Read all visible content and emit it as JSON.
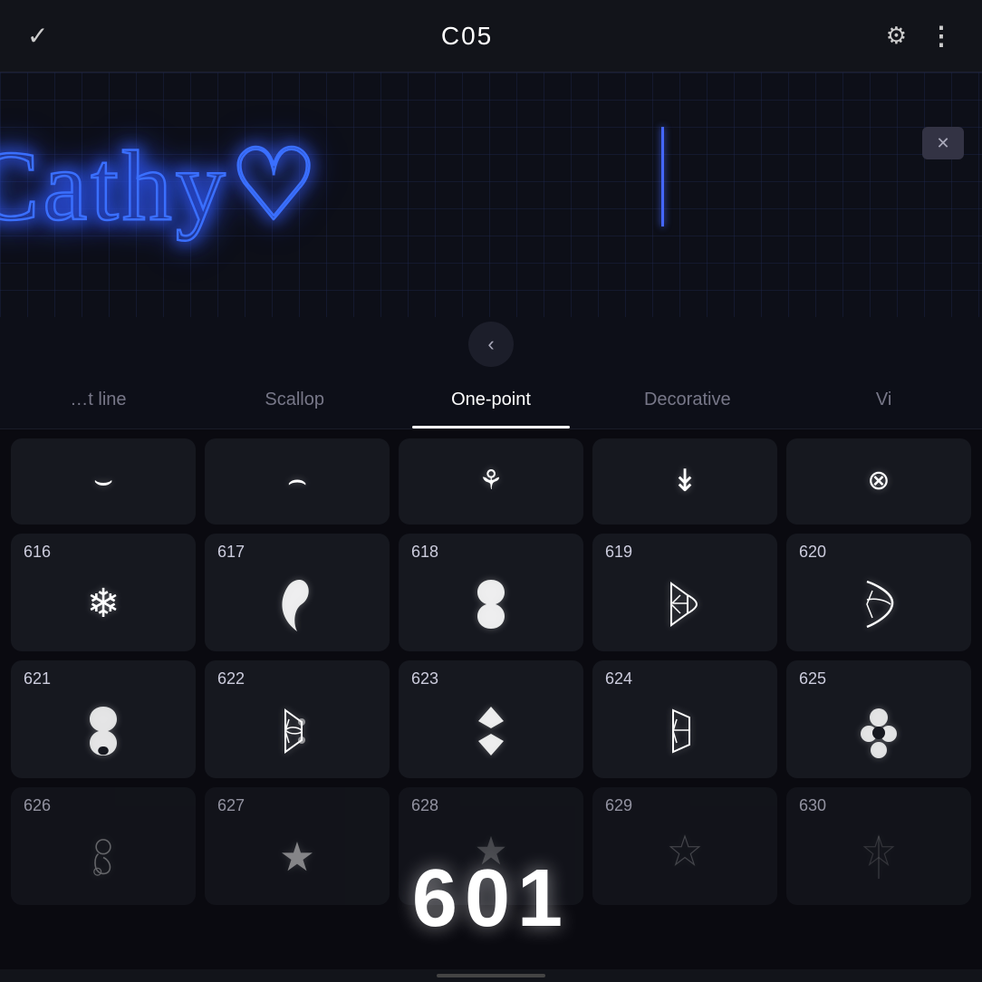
{
  "topbar": {
    "check_label": "✓",
    "title": "C05",
    "gear_label": "⚙",
    "dots_label": "⋮"
  },
  "canvas": {
    "text": "Cathy♡",
    "delete_label": "✕"
  },
  "back_button": {
    "label": "‹"
  },
  "tabs": [
    {
      "id": "straight-line",
      "label": "t line",
      "active": false
    },
    {
      "id": "scallop",
      "label": "Scallop",
      "active": false
    },
    {
      "id": "one-point",
      "label": "One-point",
      "active": true
    },
    {
      "id": "decorative",
      "label": "Decorative",
      "active": false
    },
    {
      "id": "vi",
      "label": "Vi",
      "active": false
    }
  ],
  "stitch_rows": [
    {
      "row_type": "partial",
      "cards": [
        {
          "number": "",
          "icon": "⌣"
        },
        {
          "number": "",
          "icon": "∪"
        },
        {
          "number": "",
          "icon": "⊕"
        },
        {
          "number": "",
          "icon": "↓"
        },
        {
          "number": "",
          "icon": "⊗"
        }
      ]
    },
    {
      "row_type": "full",
      "cards": [
        {
          "number": "616",
          "icon": "❄"
        },
        {
          "number": "617",
          "icon": "🌀"
        },
        {
          "number": "618",
          "icon": "🤍"
        },
        {
          "number": "619",
          "icon": "🔷"
        },
        {
          "number": "620",
          "icon": "🔺"
        }
      ]
    },
    {
      "row_type": "full",
      "cards": [
        {
          "number": "621",
          "icon": "♦"
        },
        {
          "number": "622",
          "icon": "❧"
        },
        {
          "number": "623",
          "icon": "◆"
        },
        {
          "number": "624",
          "icon": "⚑"
        },
        {
          "number": "625",
          "icon": "✿"
        }
      ]
    },
    {
      "row_type": "partial-bottom",
      "cards": [
        {
          "number": "626",
          "icon": "⚘"
        },
        {
          "number": "627",
          "icon": "★"
        },
        {
          "number": "628",
          "icon": "✦"
        },
        {
          "number": "629",
          "icon": "✧"
        },
        {
          "number": "630",
          "icon": "✩"
        }
      ]
    }
  ],
  "big_overlay_number": "601"
}
